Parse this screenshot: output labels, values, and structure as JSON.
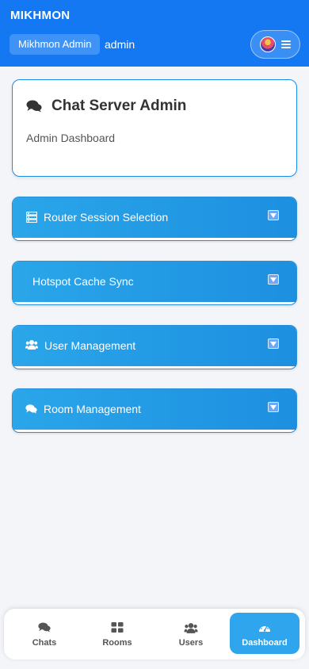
{
  "header": {
    "brand": "MIKHMON",
    "admin_chip": "Mikhmon Admin",
    "user": "admin"
  },
  "card": {
    "title": "Chat Server Admin",
    "subtitle": "Admin Dashboard"
  },
  "sections": [
    {
      "label": "Router Session Selection",
      "icon": "server-icon"
    },
    {
      "label": "Hotspot Cache Sync",
      "icon": ""
    },
    {
      "label": "User Management",
      "icon": "users-icon"
    },
    {
      "label": "Room Management",
      "icon": "comments-icon"
    }
  ],
  "nav": {
    "items": [
      {
        "label": "Chats",
        "icon": "comments-icon"
      },
      {
        "label": "Rooms",
        "icon": "grid-icon"
      },
      {
        "label": "Users",
        "icon": "users-icon"
      },
      {
        "label": "Dashboard",
        "icon": "gauge-icon",
        "active": true
      }
    ]
  },
  "colors": {
    "header": "#1478f2",
    "accordion": "#1d8fe0",
    "active_nav": "#2ea5ec"
  }
}
